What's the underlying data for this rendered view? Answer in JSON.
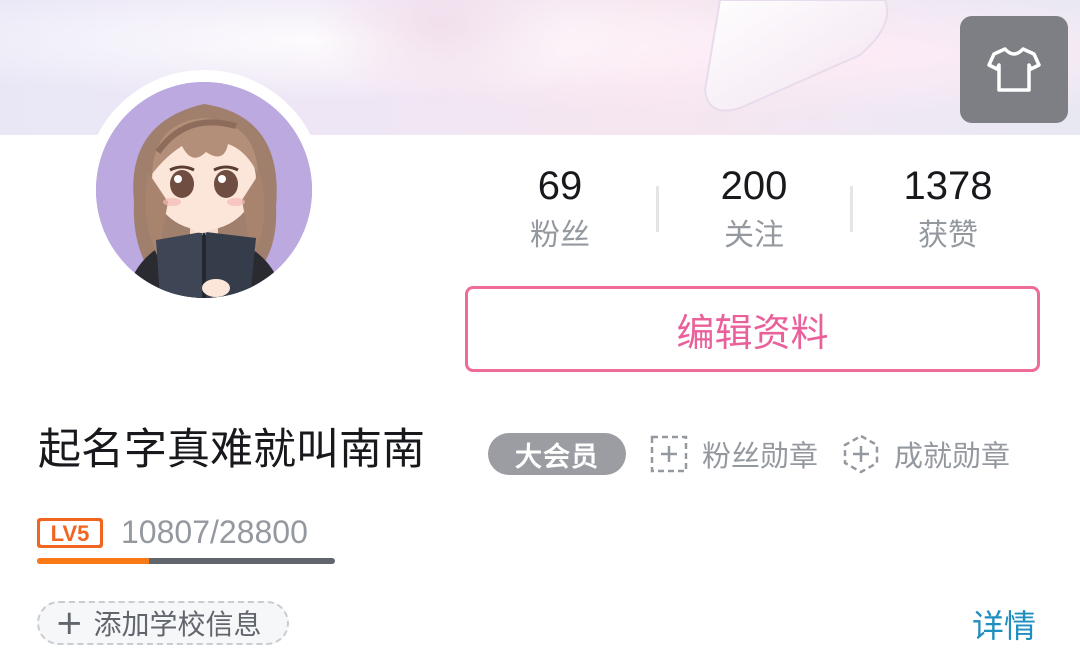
{
  "header": {
    "skin_icon": "t-shirt-icon"
  },
  "profile": {
    "avatar_icon": "anime-girl-reading-avatar",
    "username": "起名字真难就叫南南",
    "vip_badge": "大会员",
    "fan_medal_label": "粉丝勋章",
    "achievement_medal_label": "成就勋章",
    "edit_button_label": "编辑资料"
  },
  "stats": [
    {
      "value": "69",
      "label": "粉丝"
    },
    {
      "value": "200",
      "label": "关注"
    },
    {
      "value": "1378",
      "label": "获赞"
    }
  ],
  "level": {
    "badge": "LV5",
    "exp_text": "10807/28800",
    "progress_fraction": 0.375,
    "colors": {
      "badge": "#f0651f",
      "fill": "#fb7816",
      "track": "#61666d"
    }
  },
  "school": {
    "add_label": "添加学校信息",
    "plus_icon": "+"
  },
  "details_link": "详情",
  "colors": {
    "accent_pink": "#ee6c97",
    "link_blue": "#1e8fbf",
    "vip_gray": "#9b9da2",
    "skin_button": "#7d7f85"
  }
}
